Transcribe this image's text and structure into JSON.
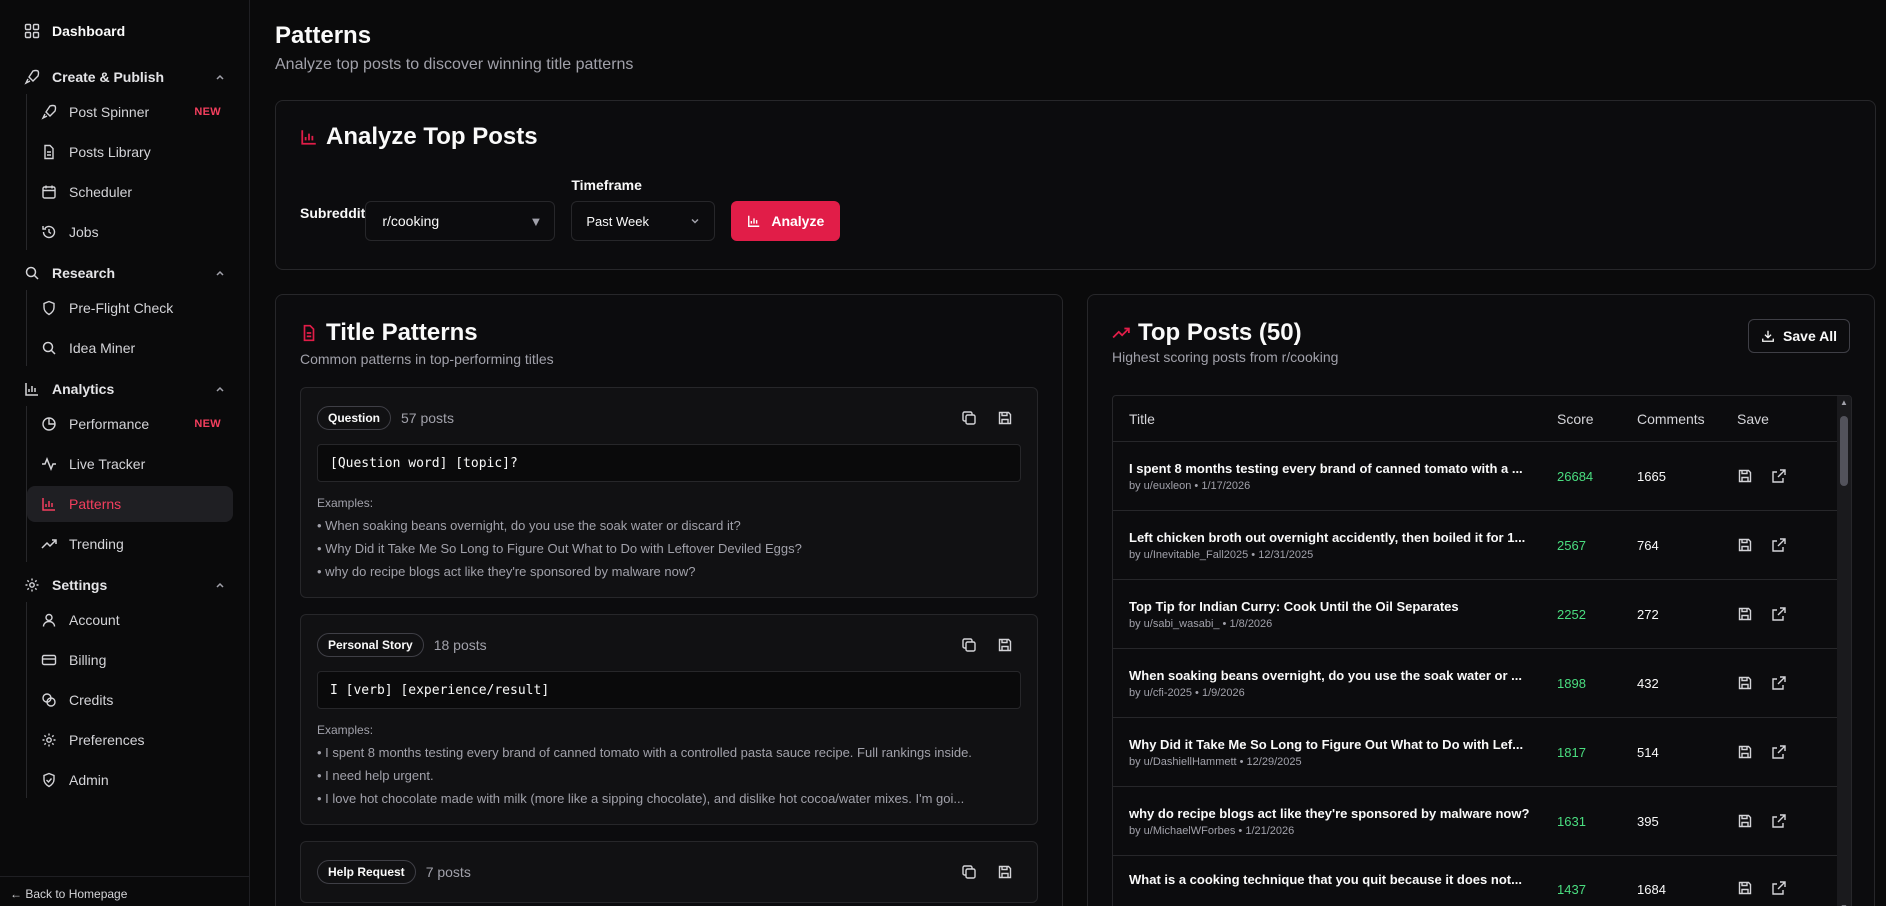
{
  "sidebar": {
    "dashboard": "Dashboard",
    "sections": [
      {
        "title": "Create & Publish",
        "items": [
          {
            "label": "Post Spinner",
            "badge": "NEW"
          },
          {
            "label": "Posts Library",
            "badge": ""
          },
          {
            "label": "Scheduler",
            "badge": ""
          },
          {
            "label": "Jobs",
            "badge": ""
          }
        ]
      },
      {
        "title": "Research",
        "items": [
          {
            "label": "Pre-Flight Check",
            "badge": ""
          },
          {
            "label": "Idea Miner",
            "badge": ""
          }
        ]
      },
      {
        "title": "Analytics",
        "items": [
          {
            "label": "Performance",
            "badge": "NEW"
          },
          {
            "label": "Live Tracker",
            "badge": ""
          },
          {
            "label": "Patterns",
            "badge": ""
          },
          {
            "label": "Trending",
            "badge": ""
          }
        ]
      },
      {
        "title": "Settings",
        "items": [
          {
            "label": "Account",
            "badge": ""
          },
          {
            "label": "Billing",
            "badge": ""
          },
          {
            "label": "Credits",
            "badge": ""
          },
          {
            "label": "Preferences",
            "badge": ""
          },
          {
            "label": "Admin",
            "badge": ""
          }
        ]
      }
    ],
    "back": "← Back to Homepage"
  },
  "header": {
    "title": "Patterns",
    "subtitle": "Analyze top posts to discover winning title patterns"
  },
  "analyze": {
    "title": "Analyze Top Posts",
    "subreddit_label": "Subreddit",
    "subreddit_value": "r/cooking",
    "timeframe_label": "Timeframe",
    "timeframe_value": "Past Week",
    "button": "Analyze"
  },
  "title_patterns": {
    "title": "Title Patterns",
    "subtitle": "Common patterns in top-performing titles",
    "examples_label": "Examples:",
    "patterns": [
      {
        "name": "Question",
        "count": "57 posts",
        "template": "[Question word] [topic]?",
        "examples": [
          "• When soaking beans overnight, do you use the soak water or discard it?",
          "• Why Did it Take Me So Long to Figure Out What to Do with Leftover Deviled Eggs?",
          "• why do recipe blogs act like they're sponsored by malware now?"
        ]
      },
      {
        "name": "Personal Story",
        "count": "18 posts",
        "template": "I [verb] [experience/result]",
        "examples": [
          "• I spent 8 months testing every brand of canned tomato with a controlled pasta sauce recipe. Full rankings inside.",
          "• I need help urgent.",
          "• I love hot chocolate made with milk (more like a sipping chocolate), and dislike hot cocoa/water mixes. I'm goi..."
        ]
      },
      {
        "name": "Help Request",
        "count": "7 posts",
        "template": "",
        "examples": []
      }
    ]
  },
  "top_posts": {
    "title": "Top Posts (50)",
    "subtitle": "Highest scoring posts from r/cooking",
    "save_all": "Save All",
    "columns": [
      "Title",
      "Score",
      "Comments",
      "Save"
    ],
    "rows": [
      {
        "title": "I spent 8 months testing every brand of canned tomato with a ...",
        "meta": "by u/euxleon • 1/17/2026",
        "score": "26684",
        "comments": "1665"
      },
      {
        "title": "Left chicken broth out overnight accidently, then boiled it for 1...",
        "meta": "by u/Inevitable_Fall2025 • 12/31/2025",
        "score": "2567",
        "comments": "764"
      },
      {
        "title": "Top Tip for Indian Curry: Cook Until the Oil Separates",
        "meta": "by u/sabi_wasabi_ • 1/8/2026",
        "score": "2252",
        "comments": "272"
      },
      {
        "title": "When soaking beans overnight, do you use the soak water or ...",
        "meta": "by u/cfi-2025 • 1/9/2026",
        "score": "1898",
        "comments": "432"
      },
      {
        "title": "Why Did it Take Me So Long to Figure Out What to Do with Lef...",
        "meta": "by u/DashiellHammett • 12/29/2025",
        "score": "1817",
        "comments": "514"
      },
      {
        "title": "why do recipe blogs act like they're sponsored by malware now?",
        "meta": "by u/MichaelWForbes • 1/21/2026",
        "score": "1631",
        "comments": "395"
      },
      {
        "title": "What is a cooking technique that you quit because it does not...",
        "meta": "",
        "score": "1437",
        "comments": "1684"
      }
    ]
  },
  "colors": {
    "accent": "#e11d48",
    "score": "#4ade80",
    "bg": "#0a0a0b"
  }
}
